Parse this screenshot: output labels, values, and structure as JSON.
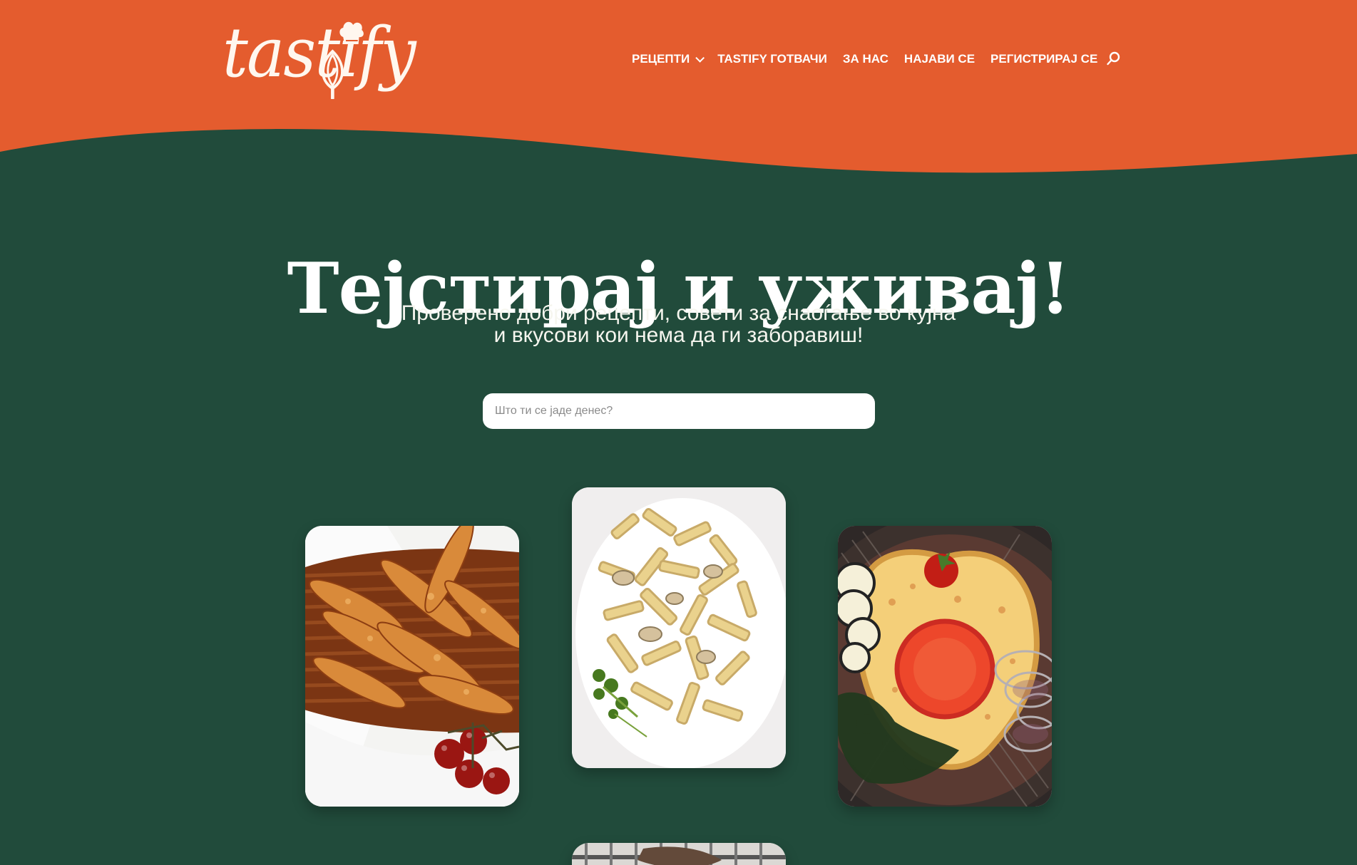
{
  "header": {
    "logo_text": "tastify",
    "nav": [
      {
        "label": "РЕЦЕПТИ",
        "has_dropdown": true
      },
      {
        "label": "TASTIFY ГОТВАЧИ"
      },
      {
        "label": "ЗА НАС"
      },
      {
        "label": "НАЈАВИ СЕ"
      },
      {
        "label": "РЕГИСТРИРАЈ СЕ"
      }
    ],
    "search_icon": "search-icon"
  },
  "hero": {
    "title": "Тејстирај и уживај!",
    "subtitle_line_1": "Проверено добри рецепти, совети за снаоѓање во кујна",
    "subtitle_line_2": "и вкусови кои нема да ги заборавиш!",
    "search_placeholder": "Што ти се јаде денес?"
  },
  "images": [
    "breadsticks-image",
    "pasta-image",
    "plate-image",
    "partial-food-image"
  ],
  "colors": {
    "header": "#e45c2e",
    "background": "#214b3b",
    "text": "#ffffff"
  }
}
